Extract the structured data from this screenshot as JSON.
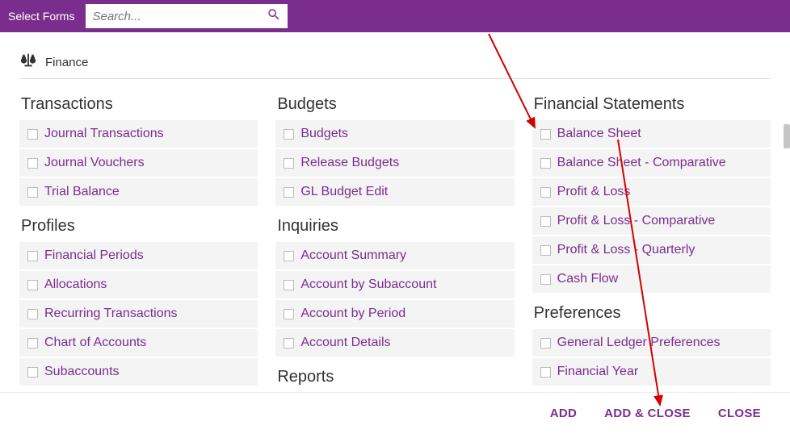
{
  "header": {
    "title": "Select Forms",
    "search_placeholder": "Search..."
  },
  "section": {
    "title": "Finance",
    "icon": "scale-icon"
  },
  "columns": [
    {
      "groups": [
        {
          "title": "Transactions",
          "items": [
            "Journal Transactions",
            "Journal Vouchers",
            "Trial Balance"
          ]
        },
        {
          "title": "Profiles",
          "items": [
            "Financial Periods",
            "Allocations",
            "Recurring Transactions",
            "Chart of Accounts",
            "Subaccounts"
          ]
        }
      ]
    },
    {
      "groups": [
        {
          "title": "Budgets",
          "items": [
            "Budgets",
            "Release Budgets",
            "GL Budget Edit"
          ]
        },
        {
          "title": "Inquiries",
          "items": [
            "Account Summary",
            "Account by Subaccount",
            "Account by Period",
            "Account Details"
          ]
        },
        {
          "title": "Reports",
          "items": []
        }
      ]
    },
    {
      "groups": [
        {
          "title": "Financial Statements",
          "items": [
            "Balance Sheet",
            "Balance Sheet - Comparative",
            "Profit & Loss",
            "Profit & Loss - Comparative",
            "Profit & Loss - Quarterly",
            "Cash Flow"
          ]
        },
        {
          "title": "Preferences",
          "items": [
            "General Ledger Preferences",
            "Financial Year"
          ]
        }
      ]
    }
  ],
  "footer": {
    "add": "ADD",
    "add_close": "ADD & CLOSE",
    "close": "CLOSE"
  },
  "colors": {
    "brand": "#7b2d8e",
    "link": "#7b2d8e",
    "item_bg": "#f4f4f4"
  }
}
